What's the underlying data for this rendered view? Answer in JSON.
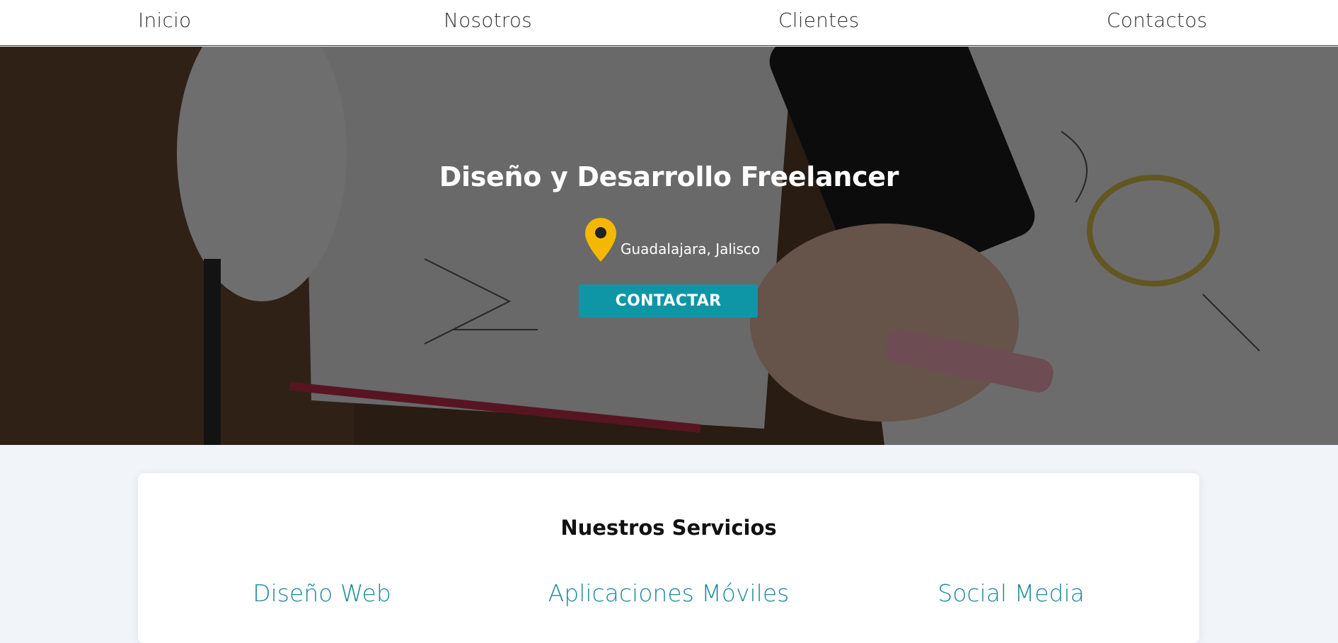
{
  "nav": {
    "items": [
      {
        "label": "Inicio"
      },
      {
        "label": "Nosotros"
      },
      {
        "label": "Clientes"
      },
      {
        "label": "Contactos"
      }
    ]
  },
  "hero": {
    "title": "Diseño y Desarrollo Freelancer",
    "location": "Guadalajara, Jalisco",
    "cta_label": "CONTACTAR"
  },
  "services": {
    "title": "Nuestros Servicios",
    "items": [
      {
        "label": "Diseño Web"
      },
      {
        "label": "Aplicaciones Móviles"
      },
      {
        "label": "Social Media"
      }
    ]
  },
  "colors": {
    "accent": "#0f96a6",
    "service_text": "#1c8a9a",
    "pin": "#f5b800"
  },
  "icons": {
    "location": "map-pin-icon"
  }
}
